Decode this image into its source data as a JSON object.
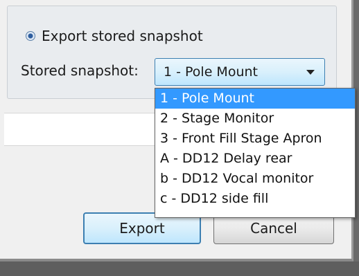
{
  "export_option": {
    "label": "Export stored snapshot",
    "selected": true
  },
  "snapshot": {
    "label": "Stored snapshot:",
    "selected_value": "1 - Pole Mount",
    "options": [
      "1 - Pole Mount",
      "2 - Stage Monitor",
      "3 - Front Fill Stage Apron",
      "A - DD12 Delay rear",
      "b - DD12 Vocal monitor",
      "c - DD12 side fill"
    ],
    "highlighted_index": 0
  },
  "buttons": {
    "export": "Export",
    "cancel": "Cancel"
  },
  "colors": {
    "highlight": "#3399ff",
    "focus_border": "#3c7fb1"
  }
}
